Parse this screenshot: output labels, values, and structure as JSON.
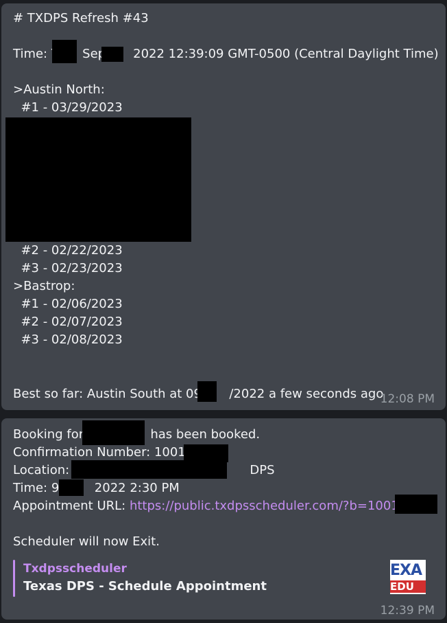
{
  "messages": [
    {
      "lines": [
        "# TXDPS Refresh #43",
        "Time: T      Sep       2022 12:39:09 GMT-0500 (Central Daylight Time)",
        ">Austin North:",
        "  #1 - 03/29/2023",
        "  #2 - 02/22/2023",
        "  #3 - 02/23/2023",
        ">Bastrop:",
        "  #1 - 02/06/2023",
        "  #2 - 02/07/2023",
        "  #3 - 02/08/2023",
        "Best so far: Austin South at 09/      /2022 a few seconds ago"
      ],
      "timestamp": "12:08 PM"
    },
    {
      "lines": [
        "Booking for                 has been booked.",
        "Confirmation Number: 1001",
        "Location:                                              DPS",
        "Time: 9         2022 2:30 PM",
        "Appointment URL: ",
        "Scheduler will now Exit."
      ],
      "url": "https://public.txdpsscheduler.com/?b=1001",
      "embed": {
        "provider": "Txdpsscheduler",
        "title": "Texas DPS - Schedule Appointment",
        "thumb_top": "EXA",
        "thumb_bottom": "EDU"
      },
      "timestamp": "12:39 PM"
    }
  ],
  "colors": {
    "background": "#1b1d21",
    "message_bg": "#41454c",
    "link": "#c48df0",
    "timestamp": "#9aa0a6"
  }
}
